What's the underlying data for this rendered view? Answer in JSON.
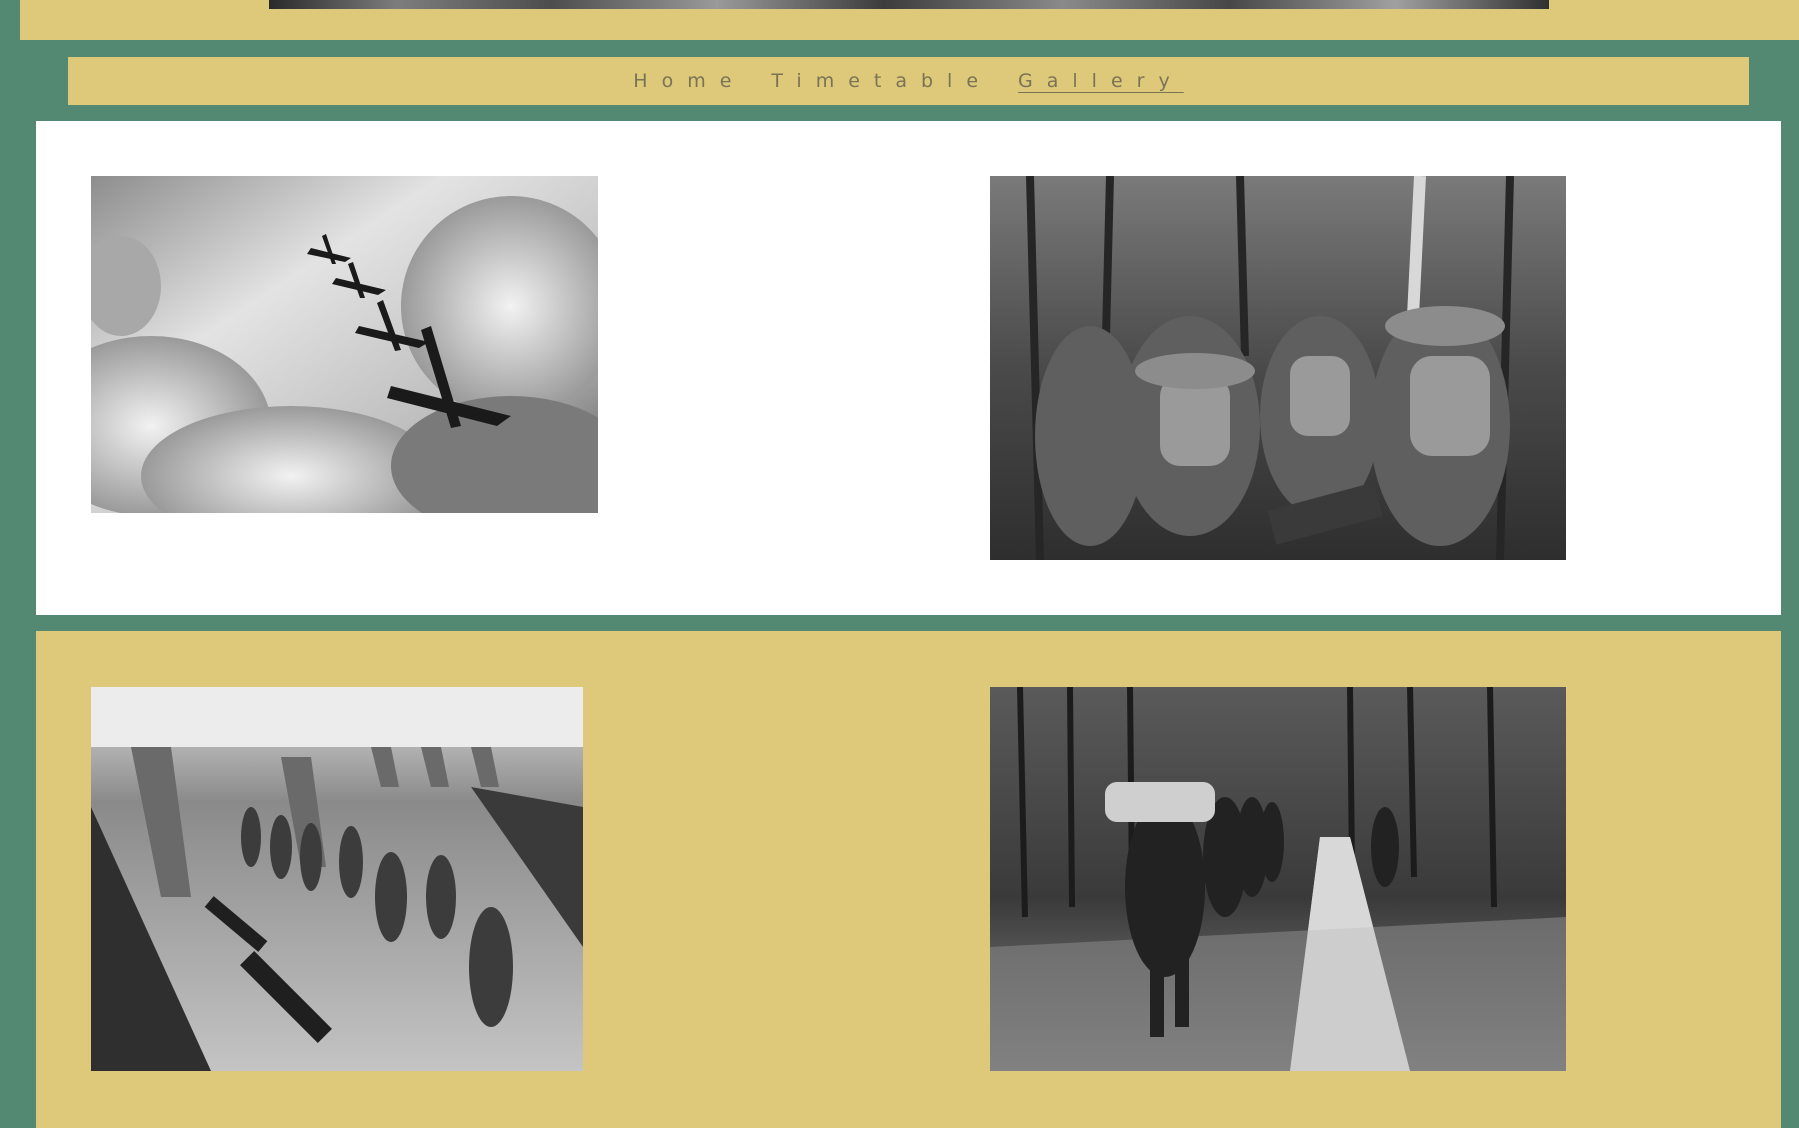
{
  "nav": {
    "items": [
      {
        "label": "Home",
        "active": false
      },
      {
        "label": "Timetable",
        "active": false
      },
      {
        "label": "Gallery",
        "active": true
      }
    ]
  },
  "gallery": {
    "photos": [
      {
        "subject": "bomber-planes-in-clouds"
      },
      {
        "subject": "soldiers-marching-in-forest-rear-view"
      },
      {
        "subject": "soldiers-running-past-tank-traps"
      },
      {
        "subject": "soldiers-walking-forest-path"
      }
    ]
  },
  "colors": {
    "background": "#538872",
    "band": "#dec87a",
    "panel": "#ffffff",
    "nav_text": "#7a7355"
  }
}
